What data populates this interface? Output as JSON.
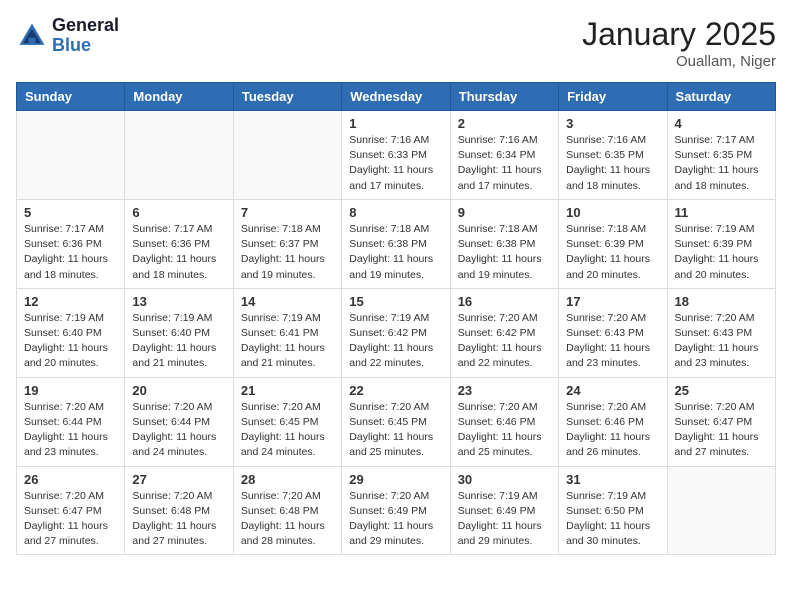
{
  "logo": {
    "line1": "General",
    "line2": "Blue"
  },
  "title": "January 2025",
  "location": "Ouallam, Niger",
  "weekdays": [
    "Sunday",
    "Monday",
    "Tuesday",
    "Wednesday",
    "Thursday",
    "Friday",
    "Saturday"
  ],
  "weeks": [
    [
      {
        "day": "",
        "sunrise": "",
        "sunset": "",
        "daylight": ""
      },
      {
        "day": "",
        "sunrise": "",
        "sunset": "",
        "daylight": ""
      },
      {
        "day": "",
        "sunrise": "",
        "sunset": "",
        "daylight": ""
      },
      {
        "day": "1",
        "sunrise": "Sunrise: 7:16 AM",
        "sunset": "Sunset: 6:33 PM",
        "daylight": "Daylight: 11 hours and 17 minutes."
      },
      {
        "day": "2",
        "sunrise": "Sunrise: 7:16 AM",
        "sunset": "Sunset: 6:34 PM",
        "daylight": "Daylight: 11 hours and 17 minutes."
      },
      {
        "day": "3",
        "sunrise": "Sunrise: 7:16 AM",
        "sunset": "Sunset: 6:35 PM",
        "daylight": "Daylight: 11 hours and 18 minutes."
      },
      {
        "day": "4",
        "sunrise": "Sunrise: 7:17 AM",
        "sunset": "Sunset: 6:35 PM",
        "daylight": "Daylight: 11 hours and 18 minutes."
      }
    ],
    [
      {
        "day": "5",
        "sunrise": "Sunrise: 7:17 AM",
        "sunset": "Sunset: 6:36 PM",
        "daylight": "Daylight: 11 hours and 18 minutes."
      },
      {
        "day": "6",
        "sunrise": "Sunrise: 7:17 AM",
        "sunset": "Sunset: 6:36 PM",
        "daylight": "Daylight: 11 hours and 18 minutes."
      },
      {
        "day": "7",
        "sunrise": "Sunrise: 7:18 AM",
        "sunset": "Sunset: 6:37 PM",
        "daylight": "Daylight: 11 hours and 19 minutes."
      },
      {
        "day": "8",
        "sunrise": "Sunrise: 7:18 AM",
        "sunset": "Sunset: 6:38 PM",
        "daylight": "Daylight: 11 hours and 19 minutes."
      },
      {
        "day": "9",
        "sunrise": "Sunrise: 7:18 AM",
        "sunset": "Sunset: 6:38 PM",
        "daylight": "Daylight: 11 hours and 19 minutes."
      },
      {
        "day": "10",
        "sunrise": "Sunrise: 7:18 AM",
        "sunset": "Sunset: 6:39 PM",
        "daylight": "Daylight: 11 hours and 20 minutes."
      },
      {
        "day": "11",
        "sunrise": "Sunrise: 7:19 AM",
        "sunset": "Sunset: 6:39 PM",
        "daylight": "Daylight: 11 hours and 20 minutes."
      }
    ],
    [
      {
        "day": "12",
        "sunrise": "Sunrise: 7:19 AM",
        "sunset": "Sunset: 6:40 PM",
        "daylight": "Daylight: 11 hours and 20 minutes."
      },
      {
        "day": "13",
        "sunrise": "Sunrise: 7:19 AM",
        "sunset": "Sunset: 6:40 PM",
        "daylight": "Daylight: 11 hours and 21 minutes."
      },
      {
        "day": "14",
        "sunrise": "Sunrise: 7:19 AM",
        "sunset": "Sunset: 6:41 PM",
        "daylight": "Daylight: 11 hours and 21 minutes."
      },
      {
        "day": "15",
        "sunrise": "Sunrise: 7:19 AM",
        "sunset": "Sunset: 6:42 PM",
        "daylight": "Daylight: 11 hours and 22 minutes."
      },
      {
        "day": "16",
        "sunrise": "Sunrise: 7:20 AM",
        "sunset": "Sunset: 6:42 PM",
        "daylight": "Daylight: 11 hours and 22 minutes."
      },
      {
        "day": "17",
        "sunrise": "Sunrise: 7:20 AM",
        "sunset": "Sunset: 6:43 PM",
        "daylight": "Daylight: 11 hours and 23 minutes."
      },
      {
        "day": "18",
        "sunrise": "Sunrise: 7:20 AM",
        "sunset": "Sunset: 6:43 PM",
        "daylight": "Daylight: 11 hours and 23 minutes."
      }
    ],
    [
      {
        "day": "19",
        "sunrise": "Sunrise: 7:20 AM",
        "sunset": "Sunset: 6:44 PM",
        "daylight": "Daylight: 11 hours and 23 minutes."
      },
      {
        "day": "20",
        "sunrise": "Sunrise: 7:20 AM",
        "sunset": "Sunset: 6:44 PM",
        "daylight": "Daylight: 11 hours and 24 minutes."
      },
      {
        "day": "21",
        "sunrise": "Sunrise: 7:20 AM",
        "sunset": "Sunset: 6:45 PM",
        "daylight": "Daylight: 11 hours and 24 minutes."
      },
      {
        "day": "22",
        "sunrise": "Sunrise: 7:20 AM",
        "sunset": "Sunset: 6:45 PM",
        "daylight": "Daylight: 11 hours and 25 minutes."
      },
      {
        "day": "23",
        "sunrise": "Sunrise: 7:20 AM",
        "sunset": "Sunset: 6:46 PM",
        "daylight": "Daylight: 11 hours and 25 minutes."
      },
      {
        "day": "24",
        "sunrise": "Sunrise: 7:20 AM",
        "sunset": "Sunset: 6:46 PM",
        "daylight": "Daylight: 11 hours and 26 minutes."
      },
      {
        "day": "25",
        "sunrise": "Sunrise: 7:20 AM",
        "sunset": "Sunset: 6:47 PM",
        "daylight": "Daylight: 11 hours and 27 minutes."
      }
    ],
    [
      {
        "day": "26",
        "sunrise": "Sunrise: 7:20 AM",
        "sunset": "Sunset: 6:47 PM",
        "daylight": "Daylight: 11 hours and 27 minutes."
      },
      {
        "day": "27",
        "sunrise": "Sunrise: 7:20 AM",
        "sunset": "Sunset: 6:48 PM",
        "daylight": "Daylight: 11 hours and 27 minutes."
      },
      {
        "day": "28",
        "sunrise": "Sunrise: 7:20 AM",
        "sunset": "Sunset: 6:48 PM",
        "daylight": "Daylight: 11 hours and 28 minutes."
      },
      {
        "day": "29",
        "sunrise": "Sunrise: 7:20 AM",
        "sunset": "Sunset: 6:49 PM",
        "daylight": "Daylight: 11 hours and 29 minutes."
      },
      {
        "day": "30",
        "sunrise": "Sunrise: 7:19 AM",
        "sunset": "Sunset: 6:49 PM",
        "daylight": "Daylight: 11 hours and 29 minutes."
      },
      {
        "day": "31",
        "sunrise": "Sunrise: 7:19 AM",
        "sunset": "Sunset: 6:50 PM",
        "daylight": "Daylight: 11 hours and 30 minutes."
      },
      {
        "day": "",
        "sunrise": "",
        "sunset": "",
        "daylight": ""
      }
    ]
  ]
}
